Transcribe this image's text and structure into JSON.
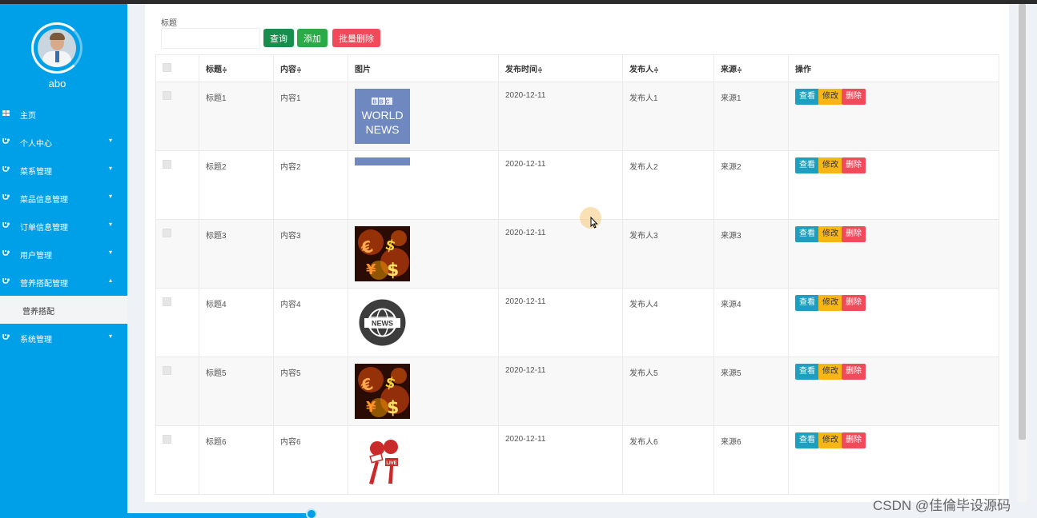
{
  "sidebar": {
    "username": "abo",
    "items": [
      {
        "label": "主页",
        "icon": "dashboard-icon",
        "chevron": ""
      },
      {
        "label": "个人中心",
        "icon": "stethoscope-icon",
        "chevron": "▾"
      },
      {
        "label": "菜系管理",
        "icon": "stethoscope-icon",
        "chevron": "▾"
      },
      {
        "label": "菜品信息管理",
        "icon": "stethoscope-icon",
        "chevron": "▾"
      },
      {
        "label": "订单信息管理",
        "icon": "stethoscope-icon",
        "chevron": "▾"
      },
      {
        "label": "用户管理",
        "icon": "stethoscope-icon",
        "chevron": "▾"
      },
      {
        "label": "营养搭配管理",
        "icon": "stethoscope-icon",
        "chevron": "▴"
      },
      {
        "label": "营养搭配",
        "icon": "",
        "chevron": ""
      },
      {
        "label": "系统管理",
        "icon": "stethoscope-icon",
        "chevron": "▾"
      }
    ]
  },
  "search": {
    "label": "标题",
    "value": "",
    "placeholder": "",
    "query_label": "查询",
    "add_label": "添加",
    "batch_delete_label": "批量删除"
  },
  "table": {
    "columns": {
      "title": "标题",
      "content": "内容",
      "image": "图片",
      "date": "发布时间",
      "publisher": "发布人",
      "source": "来源",
      "actions": "操作"
    },
    "sort_glyph": "≑",
    "rows": [
      {
        "title": "标题1",
        "content": "内容1",
        "image": "bbc-world-news-image",
        "date": "2020-12-11",
        "publisher": "发布人1",
        "source": "来源1"
      },
      {
        "title": "标题2",
        "content": "内容2",
        "image": "blue-strip-image",
        "date": "2020-12-11",
        "publisher": "发布人2",
        "source": "来源2"
      },
      {
        "title": "标题3",
        "content": "内容3",
        "image": "money-symbols-image",
        "date": "2020-12-11",
        "publisher": "发布人3",
        "source": "来源3"
      },
      {
        "title": "标题4",
        "content": "内容4",
        "image": "news-globe-image",
        "date": "2020-12-11",
        "publisher": "发布人4",
        "source": "来源4"
      },
      {
        "title": "标题5",
        "content": "内容5",
        "image": "money-symbols-image",
        "date": "2020-12-11",
        "publisher": "发布人5",
        "source": "来源5"
      },
      {
        "title": "标题6",
        "content": "内容6",
        "image": "microphones-image",
        "date": "2020-12-11",
        "publisher": "发布人6",
        "source": "来源6"
      }
    ],
    "actions": {
      "view": "查看",
      "edit": "修改",
      "delete": "删除"
    }
  },
  "images": {
    "bbc_line1": "BBC",
    "bbc_line2": "WORLD",
    "bbc_line3": "NEWS",
    "globe_text": "NEWS",
    "mic_text": "LIVE"
  },
  "watermark": "CSDN @佳倫毕设源码",
  "colors": {
    "sidebar": "#00a0e9",
    "query": "#178e4e",
    "add": "#2bab47",
    "danger": "#f04b5b",
    "view": "#1e9fbf",
    "edit": "#f7b617"
  }
}
